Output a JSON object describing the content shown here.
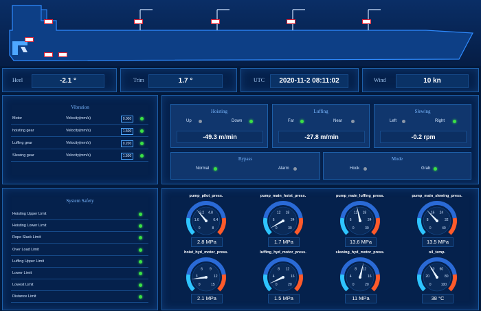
{
  "ship": {
    "tags": [
      "",
      "",
      "",
      "",
      "",
      "",
      "",
      ""
    ]
  },
  "info": [
    {
      "label": "Heel",
      "value": "-2.1 °"
    },
    {
      "label": "Trim",
      "value": "1.7 °"
    },
    {
      "label": "UTC",
      "value": "2020-11-2 08:11:02"
    },
    {
      "label": "Wind",
      "value": "10 kn"
    }
  ],
  "vibration": {
    "title": "Vibration",
    "rows": [
      {
        "label": "Motor",
        "unit": "Velocity(mm/s)",
        "value": "0.000",
        "status": "on"
      },
      {
        "label": "hoisting gear",
        "unit": "Velocity(mm/s)",
        "value": "1.500",
        "status": "on"
      },
      {
        "label": "Luffing gear",
        "unit": "Velocity(mm/s)",
        "value": "0.200",
        "status": "on"
      },
      {
        "label": "Slewing gear",
        "unit": "Velocity(mm/s)",
        "value": "1.500",
        "status": "on"
      }
    ]
  },
  "motion": [
    {
      "title": "Hoisting",
      "left": "Up",
      "left_status": "off",
      "right": "Down",
      "right_status": "on",
      "value": "-49.3 m/min"
    },
    {
      "title": "Luffing",
      "left": "Far",
      "left_status": "on",
      "right": "Near",
      "right_status": "off",
      "value": "-27.8 m/min"
    },
    {
      "title": "Slewing",
      "left": "Left",
      "left_status": "off",
      "right": "Right",
      "right_status": "on",
      "value": "-0.2 rpm"
    }
  ],
  "bypass": {
    "title": "Bypass",
    "left": "Normal",
    "left_status": "on",
    "right": "Alarm",
    "right_status": "off"
  },
  "mode": {
    "title": "Mode",
    "left": "Hook",
    "left_status": "off",
    "right": "Grab",
    "right_status": "on"
  },
  "safety": {
    "title": "System Safety",
    "rows": [
      {
        "label": "Hoisting Upper Limit",
        "status": "on"
      },
      {
        "label": "Hoisting Lower Limit",
        "status": "on"
      },
      {
        "label": "Rope Slack Limit",
        "status": "on"
      },
      {
        "label": "Over Load Limit",
        "status": "on"
      },
      {
        "label": "Luffing Upper Limit",
        "status": "on"
      },
      {
        "label": "Lower Limit",
        "status": "on"
      },
      {
        "label": "Lowest Limit",
        "status": "on"
      },
      {
        "label": "Distance Limit",
        "status": "on"
      }
    ]
  },
  "gauges": [
    {
      "name": "pump_pilot_press.",
      "ticks": [
        "0",
        "1.6",
        "3.2",
        "4.8",
        "6.4",
        "8"
      ],
      "max": 8,
      "value": 2.8,
      "display": "2.8 MPa"
    },
    {
      "name": "pump_main_hoist_press.",
      "ticks": [
        "0",
        "6",
        "12",
        "18",
        "24",
        "30"
      ],
      "max": 30,
      "value": 1.7,
      "display": "1.7 MPa"
    },
    {
      "name": "pump_main_luffing_press.",
      "ticks": [
        "0",
        "6",
        "12",
        "18",
        "24",
        "30"
      ],
      "max": 30,
      "value": 13.6,
      "display": "13.6 MPa"
    },
    {
      "name": "pump_main_slewing_press.",
      "ticks": [
        "0",
        "8",
        "16",
        "24",
        "32",
        "40"
      ],
      "max": 40,
      "value": 13.5,
      "display": "13.5 MPa"
    },
    {
      "name": "hoist_hyd_motor_press.",
      "ticks": [
        "0",
        "3",
        "6",
        "9",
        "12",
        "15"
      ],
      "max": 15,
      "value": 2.1,
      "display": "2.1 MPa"
    },
    {
      "name": "luffing_hyd_motor_press.",
      "ticks": [
        "0",
        "4",
        "8",
        "12",
        "16",
        "20"
      ],
      "max": 20,
      "value": 1.5,
      "display": "1.5 MPa"
    },
    {
      "name": "slewing_hyd_motor_press.",
      "ticks": [
        "0",
        "4",
        "8",
        "12",
        "16",
        "20"
      ],
      "max": 20,
      "value": 11,
      "display": "11 MPa"
    },
    {
      "name": "oil_temp.",
      "ticks": [
        "0",
        "20",
        "40",
        "60",
        "80",
        "100"
      ],
      "max": 100,
      "value": 38,
      "display": "38 °C"
    }
  ],
  "colors": {
    "accent": "#1d5fa8",
    "on": "#3be045",
    "off": "#8a96a8",
    "arc_low": "#2ec4ff",
    "arc_mid": "#2a6ad6",
    "arc_high": "#ff5a2a"
  }
}
